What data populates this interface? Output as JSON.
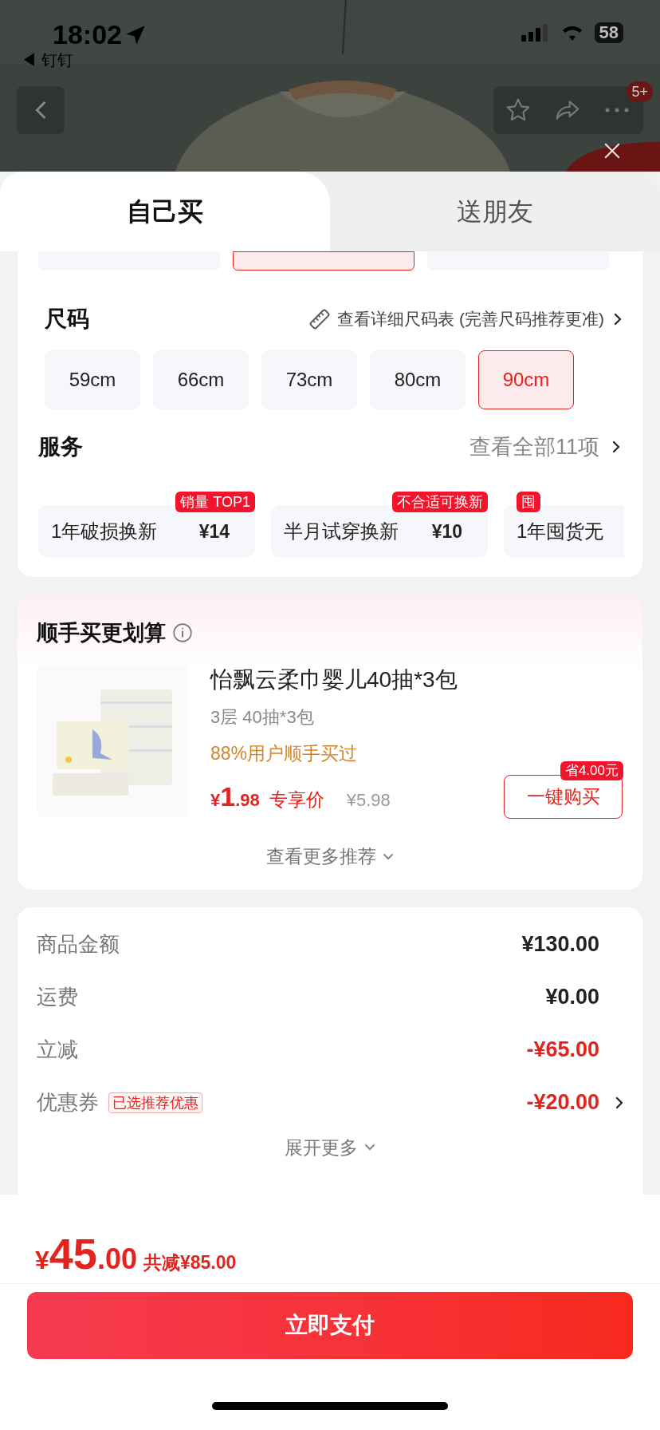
{
  "status_bar": {
    "time": "18:02",
    "back_app": "◀ 钉钉",
    "battery": "58"
  },
  "nav": {
    "badge": "5+"
  },
  "tabs": [
    {
      "label": "自己买",
      "selected": true
    },
    {
      "label": "送朋友",
      "selected": false
    }
  ],
  "color_options": [
    {
      "selected": false
    },
    {
      "selected": true
    },
    {
      "selected": false
    }
  ],
  "size": {
    "title": "尺码",
    "chart_link": "查看详细尺码表 (完善尺码推荐更准)",
    "options": [
      {
        "label": "59cm",
        "selected": false
      },
      {
        "label": "66cm",
        "selected": false
      },
      {
        "label": "73cm",
        "selected": false
      },
      {
        "label": "80cm",
        "selected": false
      },
      {
        "label": "90cm",
        "selected": true
      }
    ]
  },
  "service": {
    "title": "服务",
    "view_all": "查看全部11项",
    "items": [
      {
        "name": "1年破损换新",
        "price": "¥14",
        "tag": "销量 TOP1"
      },
      {
        "name": "半月试穿换新",
        "price": "¥10",
        "tag": "不合适可换新"
      },
      {
        "name": "1年囤货无",
        "tag": "囤"
      }
    ]
  },
  "recommend": {
    "title": "顺手买更划算",
    "product": {
      "name": "怡飘云柔巾婴儿40抽*3包",
      "spec": "3层 40抽*3包",
      "social": "88%用户顺手买过",
      "price_symbol": "¥",
      "price_int": "1",
      "price_dec": ".98",
      "price_label": "专享价",
      "original_price": "¥5.98",
      "buy": "一键购买",
      "save_tag": "省4.00元"
    },
    "more": "查看更多推荐"
  },
  "summary": {
    "rows": [
      {
        "label": "商品金额",
        "value": "¥130.00",
        "kind": "normal",
        "link": false
      },
      {
        "label": "运费",
        "value": "¥0.00",
        "kind": "normal",
        "link": false
      },
      {
        "label": "立减",
        "value": "-¥65.00",
        "kind": "discount",
        "link": false
      },
      {
        "label": "优惠券",
        "tag": "已选推荐优惠",
        "value": "-¥20.00",
        "kind": "discount",
        "link": true
      }
    ],
    "expand": "展开更多"
  },
  "footer": {
    "symbol": "¥",
    "int": "45",
    "dec": ".00",
    "saved": "共减¥85.00",
    "pay": "立即支付"
  }
}
